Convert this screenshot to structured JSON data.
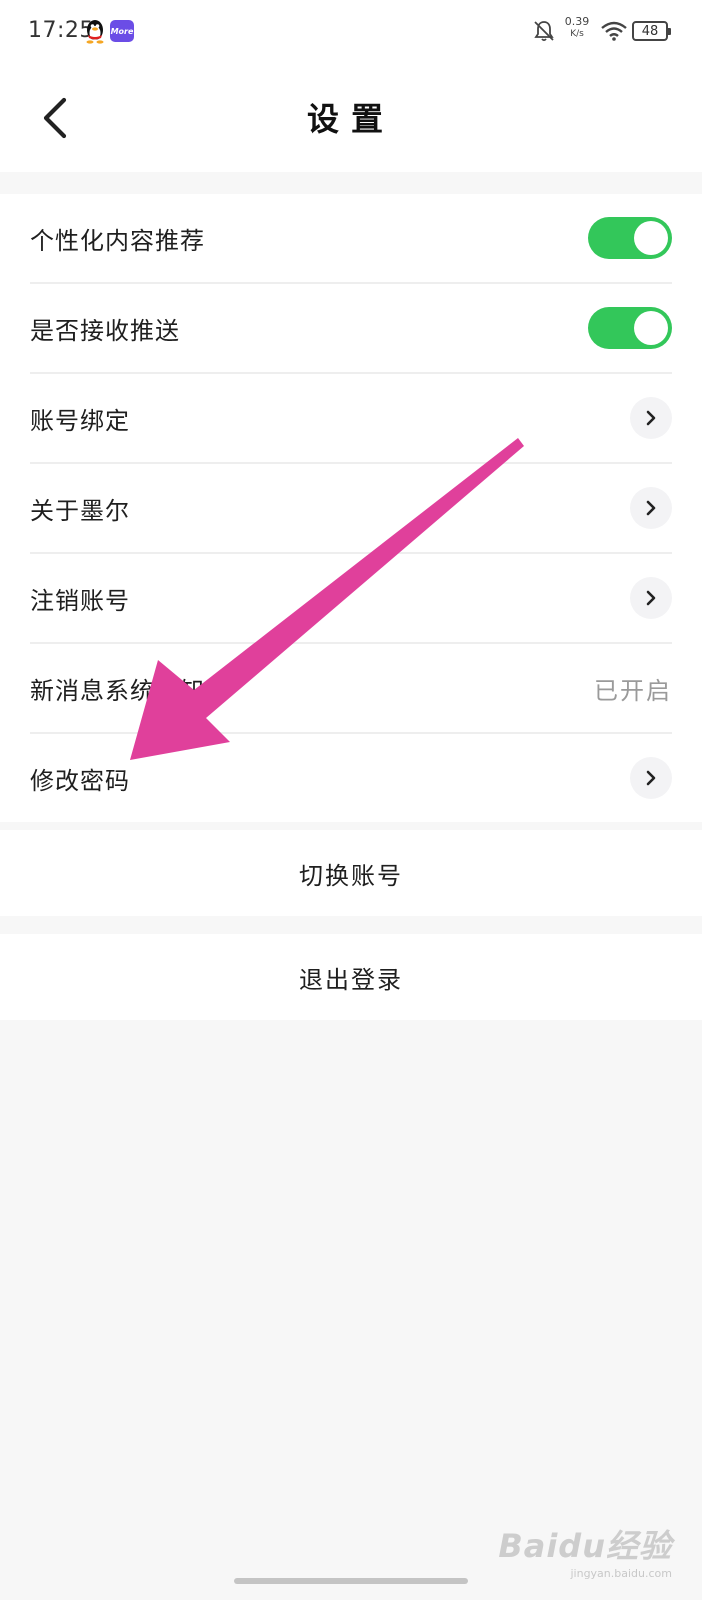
{
  "status_bar": {
    "time": "17:25",
    "more_app_label": "More",
    "net_speed_value": "0.39",
    "net_speed_unit": "K/s",
    "battery": "48"
  },
  "header": {
    "title": "设置"
  },
  "settings": {
    "items": [
      {
        "label": "个性化内容推荐",
        "type": "toggle",
        "on": true
      },
      {
        "label": "是否接收推送",
        "type": "toggle",
        "on": true
      },
      {
        "label": "账号绑定",
        "type": "link"
      },
      {
        "label": "关于墨尔",
        "type": "link"
      },
      {
        "label": "注销账号",
        "type": "link"
      },
      {
        "label": "新消息系统通知",
        "type": "value",
        "value": "已开启"
      },
      {
        "label": "修改密码",
        "type": "link"
      }
    ]
  },
  "actions": {
    "switch_account": "切换账号",
    "logout": "退出登录"
  },
  "watermark": {
    "brand": "Baidu经验",
    "site": "jingyan.baidu.com"
  },
  "colors": {
    "toggle_on": "#33c75a",
    "annotation_arrow": "#e0409b",
    "background": "#f7f7f7"
  }
}
